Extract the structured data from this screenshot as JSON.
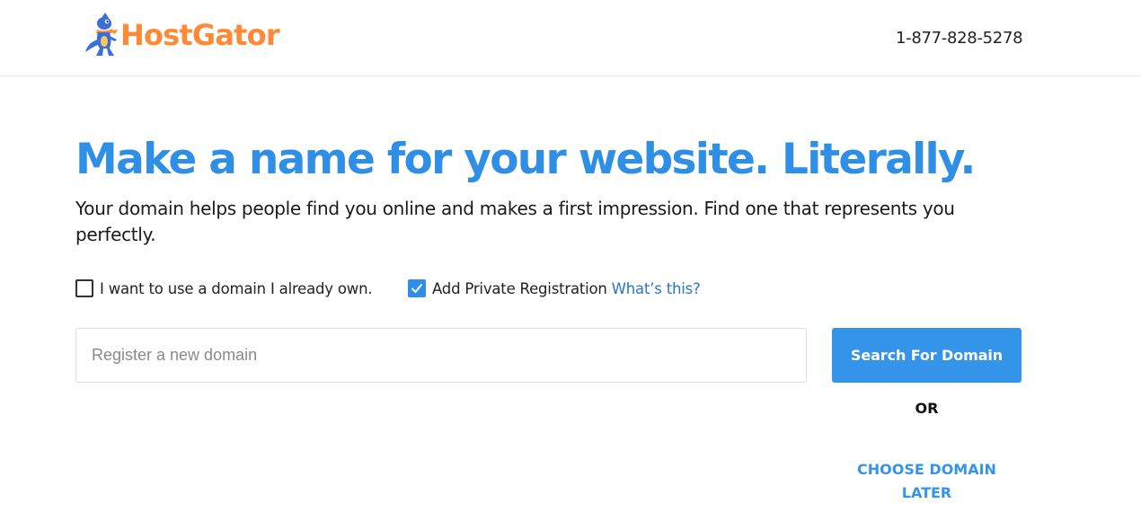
{
  "header": {
    "logo_text": "HostGator",
    "phone": "1-877-828-5278"
  },
  "main": {
    "headline": "Make a name for your website. Literally.",
    "subtext": "Your domain helps people find you online and makes a first impression. Find one that represents you perfectly."
  },
  "options": {
    "own_domain": {
      "label": "I want to use a domain I already own.",
      "checked": false
    },
    "private_registration": {
      "label": "Add Private Registration",
      "checked": true,
      "link": "What’s this?"
    }
  },
  "search": {
    "placeholder": "Register a new domain",
    "value": "",
    "button_label": "Search For Domain"
  },
  "alternative": {
    "or_label": "OR",
    "choose_later_line1": "CHOOSE DOMAIN",
    "choose_later_line2": "LATER"
  },
  "colors": {
    "brand_orange": "#ff8a35",
    "primary_blue": "#2f8fe6",
    "link_blue": "#2a75c7"
  },
  "icons": {
    "logo": "hostgator-gator-mascot-icon",
    "check": "checkmark-icon"
  }
}
